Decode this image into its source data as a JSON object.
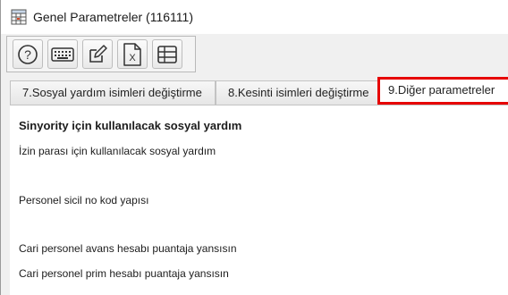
{
  "window": {
    "title": "Genel Parametreler (116111)",
    "icon": "spreadsheet-app-icon"
  },
  "toolbar": {
    "buttons": [
      {
        "icon": "help-icon",
        "label": "?"
      },
      {
        "icon": "keyboard-icon"
      },
      {
        "icon": "edit-icon"
      },
      {
        "icon": "excel-icon",
        "label": "X"
      },
      {
        "icon": "table-icon"
      }
    ]
  },
  "tabs": [
    {
      "label": "7.Sosyal yardım isimleri değiştirme",
      "selected": false
    },
    {
      "label": "8.Kesinti isimleri değiştirme",
      "selected": false
    },
    {
      "label": "9.Diğer parametreler",
      "selected": true,
      "highlight_color": "#e60000"
    }
  ],
  "parameters": [
    {
      "label": "Sinyority için kullanılacak sosyal yardım",
      "bold": true
    },
    {
      "label": "İzin parası için kullanılacak sosyal yardım",
      "bold": false
    },
    {
      "label": "Personel sicil no kod yapısı",
      "bold": false
    },
    {
      "label": "Cari personel avans hesabı puantaja yansısın",
      "bold": false
    },
    {
      "label": "Cari personel prim hesabı puantaja yansısın",
      "bold": false
    }
  ]
}
